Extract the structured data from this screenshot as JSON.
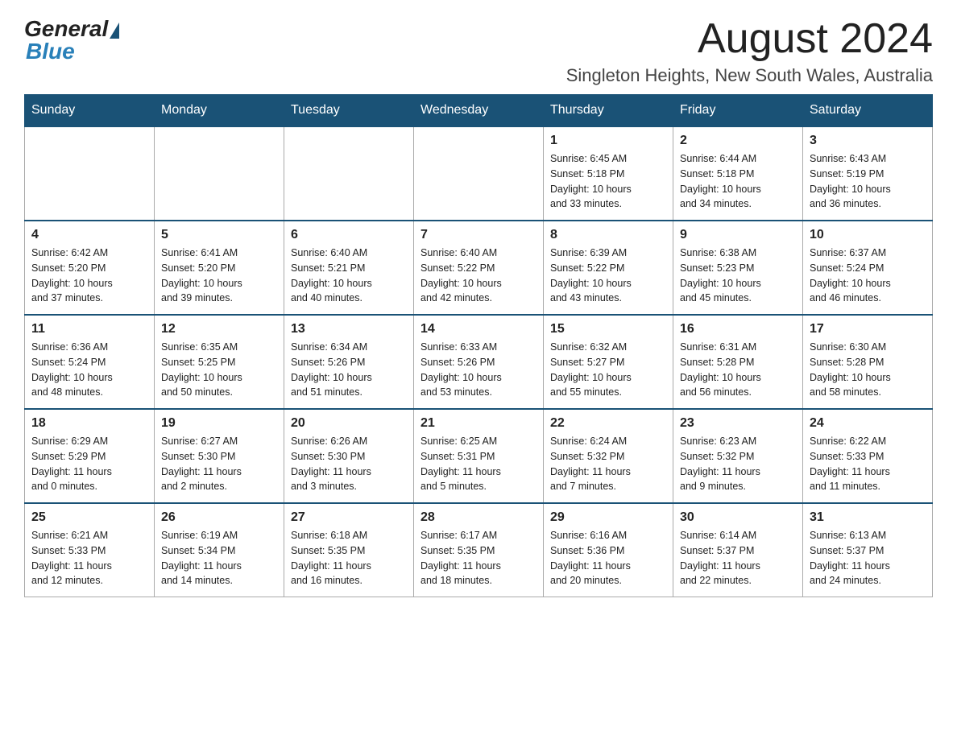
{
  "logo": {
    "general": "General",
    "blue": "Blue"
  },
  "header": {
    "month_year": "August 2024",
    "location": "Singleton Heights, New South Wales, Australia"
  },
  "days_of_week": [
    "Sunday",
    "Monday",
    "Tuesday",
    "Wednesday",
    "Thursday",
    "Friday",
    "Saturday"
  ],
  "weeks": [
    [
      {
        "day": "",
        "info": ""
      },
      {
        "day": "",
        "info": ""
      },
      {
        "day": "",
        "info": ""
      },
      {
        "day": "",
        "info": ""
      },
      {
        "day": "1",
        "info": "Sunrise: 6:45 AM\nSunset: 5:18 PM\nDaylight: 10 hours\nand 33 minutes."
      },
      {
        "day": "2",
        "info": "Sunrise: 6:44 AM\nSunset: 5:18 PM\nDaylight: 10 hours\nand 34 minutes."
      },
      {
        "day": "3",
        "info": "Sunrise: 6:43 AM\nSunset: 5:19 PM\nDaylight: 10 hours\nand 36 minutes."
      }
    ],
    [
      {
        "day": "4",
        "info": "Sunrise: 6:42 AM\nSunset: 5:20 PM\nDaylight: 10 hours\nand 37 minutes."
      },
      {
        "day": "5",
        "info": "Sunrise: 6:41 AM\nSunset: 5:20 PM\nDaylight: 10 hours\nand 39 minutes."
      },
      {
        "day": "6",
        "info": "Sunrise: 6:40 AM\nSunset: 5:21 PM\nDaylight: 10 hours\nand 40 minutes."
      },
      {
        "day": "7",
        "info": "Sunrise: 6:40 AM\nSunset: 5:22 PM\nDaylight: 10 hours\nand 42 minutes."
      },
      {
        "day": "8",
        "info": "Sunrise: 6:39 AM\nSunset: 5:22 PM\nDaylight: 10 hours\nand 43 minutes."
      },
      {
        "day": "9",
        "info": "Sunrise: 6:38 AM\nSunset: 5:23 PM\nDaylight: 10 hours\nand 45 minutes."
      },
      {
        "day": "10",
        "info": "Sunrise: 6:37 AM\nSunset: 5:24 PM\nDaylight: 10 hours\nand 46 minutes."
      }
    ],
    [
      {
        "day": "11",
        "info": "Sunrise: 6:36 AM\nSunset: 5:24 PM\nDaylight: 10 hours\nand 48 minutes."
      },
      {
        "day": "12",
        "info": "Sunrise: 6:35 AM\nSunset: 5:25 PM\nDaylight: 10 hours\nand 50 minutes."
      },
      {
        "day": "13",
        "info": "Sunrise: 6:34 AM\nSunset: 5:26 PM\nDaylight: 10 hours\nand 51 minutes."
      },
      {
        "day": "14",
        "info": "Sunrise: 6:33 AM\nSunset: 5:26 PM\nDaylight: 10 hours\nand 53 minutes."
      },
      {
        "day": "15",
        "info": "Sunrise: 6:32 AM\nSunset: 5:27 PM\nDaylight: 10 hours\nand 55 minutes."
      },
      {
        "day": "16",
        "info": "Sunrise: 6:31 AM\nSunset: 5:28 PM\nDaylight: 10 hours\nand 56 minutes."
      },
      {
        "day": "17",
        "info": "Sunrise: 6:30 AM\nSunset: 5:28 PM\nDaylight: 10 hours\nand 58 minutes."
      }
    ],
    [
      {
        "day": "18",
        "info": "Sunrise: 6:29 AM\nSunset: 5:29 PM\nDaylight: 11 hours\nand 0 minutes."
      },
      {
        "day": "19",
        "info": "Sunrise: 6:27 AM\nSunset: 5:30 PM\nDaylight: 11 hours\nand 2 minutes."
      },
      {
        "day": "20",
        "info": "Sunrise: 6:26 AM\nSunset: 5:30 PM\nDaylight: 11 hours\nand 3 minutes."
      },
      {
        "day": "21",
        "info": "Sunrise: 6:25 AM\nSunset: 5:31 PM\nDaylight: 11 hours\nand 5 minutes."
      },
      {
        "day": "22",
        "info": "Sunrise: 6:24 AM\nSunset: 5:32 PM\nDaylight: 11 hours\nand 7 minutes."
      },
      {
        "day": "23",
        "info": "Sunrise: 6:23 AM\nSunset: 5:32 PM\nDaylight: 11 hours\nand 9 minutes."
      },
      {
        "day": "24",
        "info": "Sunrise: 6:22 AM\nSunset: 5:33 PM\nDaylight: 11 hours\nand 11 minutes."
      }
    ],
    [
      {
        "day": "25",
        "info": "Sunrise: 6:21 AM\nSunset: 5:33 PM\nDaylight: 11 hours\nand 12 minutes."
      },
      {
        "day": "26",
        "info": "Sunrise: 6:19 AM\nSunset: 5:34 PM\nDaylight: 11 hours\nand 14 minutes."
      },
      {
        "day": "27",
        "info": "Sunrise: 6:18 AM\nSunset: 5:35 PM\nDaylight: 11 hours\nand 16 minutes."
      },
      {
        "day": "28",
        "info": "Sunrise: 6:17 AM\nSunset: 5:35 PM\nDaylight: 11 hours\nand 18 minutes."
      },
      {
        "day": "29",
        "info": "Sunrise: 6:16 AM\nSunset: 5:36 PM\nDaylight: 11 hours\nand 20 minutes."
      },
      {
        "day": "30",
        "info": "Sunrise: 6:14 AM\nSunset: 5:37 PM\nDaylight: 11 hours\nand 22 minutes."
      },
      {
        "day": "31",
        "info": "Sunrise: 6:13 AM\nSunset: 5:37 PM\nDaylight: 11 hours\nand 24 minutes."
      }
    ]
  ]
}
